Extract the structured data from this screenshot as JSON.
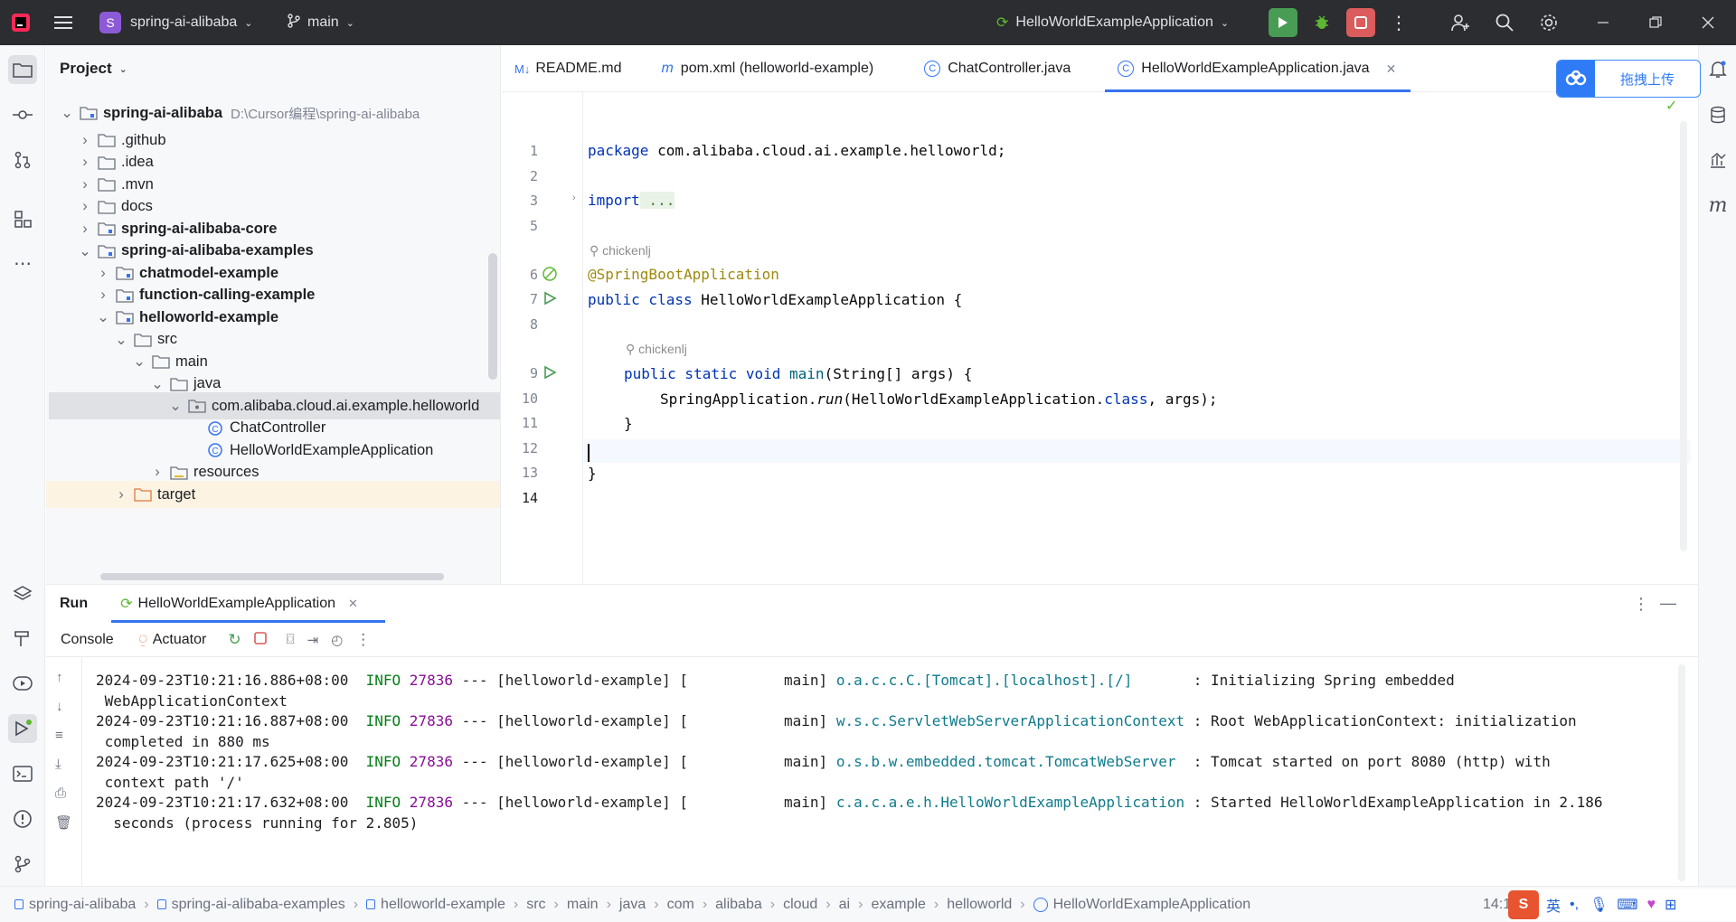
{
  "titlebar": {
    "project_letter": "S",
    "project_name": "spring-ai-alibaba",
    "branch": "main",
    "run_config": "HelloWorldExampleApplication"
  },
  "project": {
    "title": "Project",
    "root": {
      "name": "spring-ai-alibaba",
      "path": "D:\\Cursor编程\\spring-ai-alibaba"
    },
    "items": [
      {
        "label": ".github"
      },
      {
        "label": ".idea"
      },
      {
        "label": ".mvn"
      },
      {
        "label": "docs"
      },
      {
        "label": "spring-ai-alibaba-core"
      },
      {
        "label": "spring-ai-alibaba-examples"
      },
      {
        "label": "chatmodel-example"
      },
      {
        "label": "function-calling-example"
      },
      {
        "label": "helloworld-example"
      },
      {
        "label": "src"
      },
      {
        "label": "main"
      },
      {
        "label": "java"
      },
      {
        "label": "com.alibaba.cloud.ai.example.helloworld"
      },
      {
        "label": "ChatController"
      },
      {
        "label": "HelloWorldExampleApplication"
      },
      {
        "label": "resources"
      },
      {
        "label": "target"
      }
    ]
  },
  "editor": {
    "tabs": [
      {
        "label": "README.md",
        "icon": "M↓"
      },
      {
        "label": "pom.xml (helloworld-example)",
        "icon": "m"
      },
      {
        "label": "ChatController.java",
        "icon": "C"
      },
      {
        "label": "HelloWorldExampleApplication.java",
        "icon": "C"
      }
    ],
    "line_numbers": [
      "1",
      "2",
      "3",
      "5",
      "6",
      "7",
      "8",
      "9",
      "10",
      "11",
      "12",
      "13",
      "14"
    ],
    "code": {
      "l1_kw": "package",
      "l1_rest": " com.alibaba.cloud.ai.example.helloworld;",
      "l3_kw": "import",
      "l3_fold": " ...",
      "author1": "chickenlj",
      "l6": "@SpringBootApplication",
      "l7_kw": "public class",
      "l7_rest": " HelloWorldExampleApplication {",
      "author2": "chickenlj",
      "l9_kw": "public static void",
      "l9_fn": "main",
      "l9_rest": "(String[] args) {",
      "l10_a": "SpringApplication.",
      "l10_fn": "run",
      "l10_b": "(HelloWorldExampleApplication.",
      "l10_kw": "class",
      "l10_c": ", args);",
      "l11": "}",
      "l13": "}"
    }
  },
  "run": {
    "tab_run": "Run",
    "tab_app": "HelloWorldExampleApplication",
    "console": "Console",
    "actuator": "Actuator",
    "logs": [
      {
        "ts": "2024-09-23T10:21:16.886+08:00",
        "level": "INFO",
        "pid": "27836",
        "mid": " --- [helloworld-example] [           main] ",
        "logger": "o.a.c.c.C.[Tomcat].[localhost].[/]      ",
        "msg": " : Initializing Spring embedded",
        "cont": " WebApplicationContext"
      },
      {
        "ts": "2024-09-23T10:21:16.887+08:00",
        "level": "INFO",
        "pid": "27836",
        "mid": " --- [helloworld-example] [           main] ",
        "logger": "w.s.c.ServletWebServerApplicationContext",
        "msg": " : Root WebApplicationContext: initialization",
        "cont": " completed in 880 ms"
      },
      {
        "ts": "2024-09-23T10:21:17.625+08:00",
        "level": "INFO",
        "pid": "27836",
        "mid": " --- [helloworld-example] [           main] ",
        "logger": "o.s.b.w.embedded.tomcat.TomcatWebServer ",
        "msg": " : Tomcat started on port 8080 (http) with",
        "cont": " context path '/'"
      },
      {
        "ts": "2024-09-23T10:21:17.632+08:00",
        "level": "INFO",
        "pid": "27836",
        "mid": " --- [helloworld-example] [           main] ",
        "logger": "c.a.c.a.e.h.HelloWorldExampleApplication",
        "msg": " : Started HelloWorldExampleApplication in 2.186",
        "cont": "  seconds (process running for 2.805)"
      }
    ]
  },
  "statusbar": {
    "crumbs": [
      "spring-ai-alibaba",
      "spring-ai-alibaba-examples",
      "helloworld-example",
      "src",
      "main",
      "java",
      "com",
      "alibaba",
      "cloud",
      "ai",
      "example",
      "helloworld",
      "HelloWorldExampleApplication"
    ],
    "position": "14:1"
  },
  "overlay": {
    "upload_label": "拖拽上传",
    "ime": "英"
  },
  "colors": {
    "accent": "#3574f0",
    "run_green": "#499c54",
    "stop_red": "#db5c5c",
    "titlebar": "#2b2d30"
  }
}
